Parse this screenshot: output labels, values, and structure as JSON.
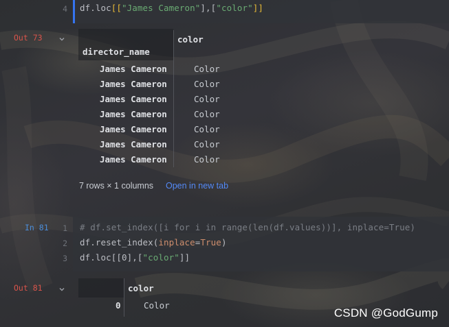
{
  "cell_top": {
    "line_number": "4",
    "code": {
      "prefix": "df.loc",
      "open": "[[",
      "str1": "\"James Cameron\"",
      "mid": "],[",
      "str2": "\"color\"",
      "close": "]]"
    }
  },
  "output_73": {
    "prompt": "Out 73",
    "column_header": "color",
    "index_name": "director_name",
    "rows": [
      {
        "index": "James Cameron",
        "value": "Color"
      },
      {
        "index": "James Cameron",
        "value": "Color"
      },
      {
        "index": "James Cameron",
        "value": "Color"
      },
      {
        "index": "James Cameron",
        "value": "Color"
      },
      {
        "index": "James Cameron",
        "value": "Color"
      },
      {
        "index": "James Cameron",
        "value": "Color"
      },
      {
        "index": "James Cameron",
        "value": "Color"
      }
    ],
    "summary": "7 rows × 1 columns",
    "open_tab_link": "Open in new tab"
  },
  "cell_81": {
    "prompt": "In 81",
    "line_numbers": [
      "1",
      "2",
      "3"
    ],
    "line1": "# df.set_index([i for i in range(len(df.values))], inplace=True)",
    "line2": {
      "prefix": "df.reset_index(",
      "kw": "inplace",
      "eq": "=",
      "val": "True",
      "suffix": ")"
    },
    "line3": {
      "prefix": "df.loc[[0],[",
      "str": "\"color\"",
      "suffix": "]]"
    }
  },
  "output_81": {
    "prompt": "Out 81",
    "column_header": "color",
    "rows": [
      {
        "index": "0",
        "value": "Color"
      }
    ]
  },
  "watermark": "CSDN @GodGump"
}
